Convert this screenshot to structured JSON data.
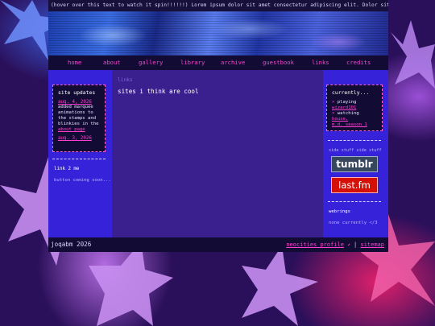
{
  "marquee": "(hover over this text to watch it spin!!!!!!) Lorem ipsum dolor sit amet consectetur adipiscing elit. Dolor sit amet consectetur adipiscing",
  "nav": [
    "home",
    "about",
    "gallery",
    "library",
    "archive",
    "guestbook",
    "links",
    "credits"
  ],
  "left": {
    "updates_title": "site updates",
    "update1_date": "aug. 4, 2026",
    "update1_text": "added marquee animations to the stamps and blinkies in the",
    "update1_link": "about page",
    "update2_date": "aug. 3, 2026",
    "link_title": "link 2 me",
    "link_text": "button coming soon..."
  },
  "main": {
    "breadcrumb": "links",
    "heading": "sites i think are cool"
  },
  "right": {
    "currently_title": "currently...",
    "playing_label": "playing",
    "playing_link": "wizard101",
    "watching_label": "watching",
    "watching_link_1": "house,",
    "watching_link_2": "m.d. season 1",
    "side_stuff": "side stuff side stuff",
    "tumblr": "tumblr",
    "lastfm": "last.fm",
    "webrings_title": "webrings",
    "webrings_text": "none currently </3"
  },
  "footer": {
    "copyright": "joqabm 2026",
    "neocities": "neocities profile",
    "neocities_arrow": "⬈",
    "separator": "|",
    "sitemap": "sitemap"
  },
  "colors": {
    "accent_pink": "#ff3fd0",
    "sidebar_blue": "#3623d9",
    "main_purple": "#3a1f8f",
    "nav_dark": "#120c34",
    "tumblr_blue": "#36465d",
    "lastfm_red": "#d51007"
  }
}
